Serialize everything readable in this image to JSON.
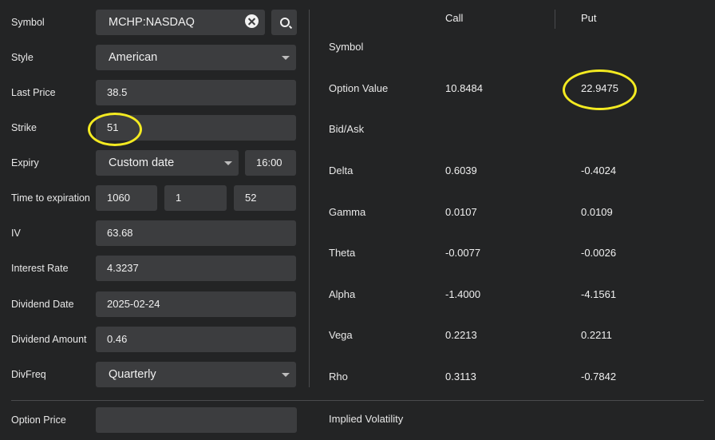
{
  "form": {
    "symbol": {
      "label": "Symbol",
      "value": "MCHP:NASDAQ"
    },
    "style": {
      "label": "Style",
      "value": "American"
    },
    "last_price": {
      "label": "Last Price",
      "value": "38.5"
    },
    "strike": {
      "label": "Strike",
      "value": "51"
    },
    "expiry": {
      "label": "Expiry",
      "value": "Custom date",
      "time": "16:00"
    },
    "time_to_expiration": {
      "label": "Time to expiration",
      "days": "1060",
      "hours": "1",
      "minutes": "52"
    },
    "iv": {
      "label": "IV",
      "value": "63.68"
    },
    "interest_rate": {
      "label": "Interest Rate",
      "value": "4.3237"
    },
    "dividend_date": {
      "label": "Dividend Date",
      "value": "2025-02-24"
    },
    "dividend_amount": {
      "label": "Dividend Amount",
      "value": "0.46"
    },
    "div_freq": {
      "label": "DivFreq",
      "value": "Quarterly"
    },
    "option_price": {
      "label": "Option Price",
      "value": ""
    }
  },
  "results": {
    "col_call": "Call",
    "col_put": "Put",
    "rows": [
      {
        "label": "Symbol",
        "call": "",
        "put": ""
      },
      {
        "label": "Option Value",
        "call": "10.8484",
        "put": "22.9475"
      },
      {
        "label": "Bid/Ask",
        "call": "",
        "put": ""
      },
      {
        "label": "Delta",
        "call": "0.6039",
        "put": "-0.4024"
      },
      {
        "label": "Gamma",
        "call": "0.0107",
        "put": "0.0109"
      },
      {
        "label": "Theta",
        "call": "-0.0077",
        "put": "-0.0026"
      },
      {
        "label": "Alpha",
        "call": "-1.4000",
        "put": "-4.1561"
      },
      {
        "label": "Vega",
        "call": "0.2213",
        "put": "0.2211"
      },
      {
        "label": "Rho",
        "call": "0.3113",
        "put": "-0.7842"
      }
    ],
    "implied_volatility_label": "Implied Volatility"
  },
  "icons": {
    "clear": "clear-icon",
    "search": "search-icon",
    "dropdown": "chevron-down-icon"
  },
  "colors": {
    "background": "#232425",
    "field": "#3c3d3f",
    "highlight": "#f3ea21"
  }
}
